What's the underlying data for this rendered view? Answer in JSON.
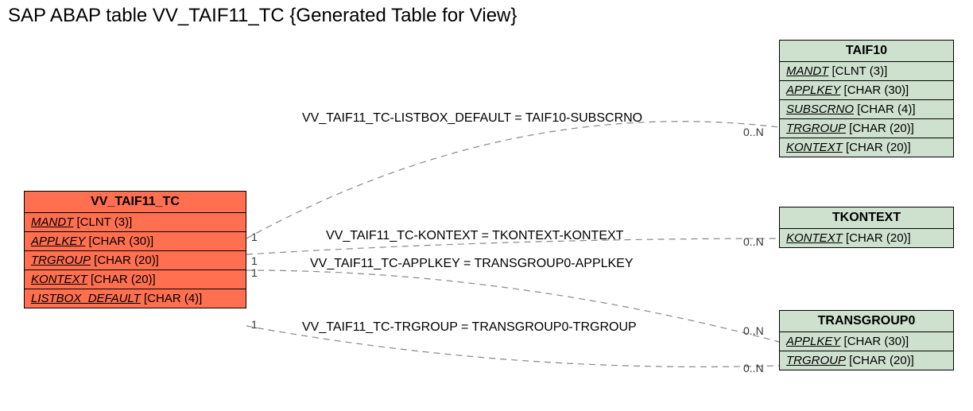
{
  "title": "SAP ABAP table VV_TAIF11_TC {Generated Table for View}",
  "entities": {
    "main": {
      "name": "VV_TAIF11_TC",
      "fields": [
        {
          "key": "MANDT",
          "type": "[CLNT (3)]"
        },
        {
          "key": "APPLKEY",
          "type": "[CHAR (30)]"
        },
        {
          "key": "TRGROUP",
          "type": "[CHAR (20)]"
        },
        {
          "key": "KONTEXT",
          "type": "[CHAR (20)]"
        },
        {
          "key": "LISTBOX_DEFAULT",
          "type": "[CHAR (4)]"
        }
      ]
    },
    "taif10": {
      "name": "TAIF10",
      "fields": [
        {
          "key": "MANDT",
          "type": "[CLNT (3)]"
        },
        {
          "key": "APPLKEY",
          "type": "[CHAR (30)]"
        },
        {
          "key": "SUBSCRNO",
          "type": "[CHAR (4)]"
        },
        {
          "key": "TRGROUP",
          "type": "[CHAR (20)]"
        },
        {
          "key": "KONTEXT",
          "type": "[CHAR (20)]"
        }
      ]
    },
    "tkontext": {
      "name": "TKONTEXT",
      "fields": [
        {
          "key": "KONTEXT",
          "type": "[CHAR (20)]"
        }
      ]
    },
    "transgroup0": {
      "name": "TRANSGROUP0",
      "fields": [
        {
          "key": "APPLKEY",
          "type": "[CHAR (30)]"
        },
        {
          "key": "TRGROUP",
          "type": "[CHAR (20)]"
        }
      ]
    }
  },
  "relations": {
    "r1": {
      "label": "VV_TAIF11_TC-LISTBOX_DEFAULT = TAIF10-SUBSCRNO",
      "left_card": "1",
      "right_card": "0..N"
    },
    "r2": {
      "label": "VV_TAIF11_TC-KONTEXT = TKONTEXT-KONTEXT",
      "left_card": "1",
      "right_card": "0..N"
    },
    "r3": {
      "label": "VV_TAIF11_TC-APPLKEY = TRANSGROUP0-APPLKEY",
      "left_card": "1",
      "right_card": "0..N"
    },
    "r4": {
      "label": "VV_TAIF11_TC-TRGROUP = TRANSGROUP0-TRGROUP",
      "left_card": "1",
      "right_card": "0..N"
    }
  },
  "chart_data": {
    "type": "table",
    "description": "Entity-relationship diagram for SAP ABAP view VV_TAIF11_TC",
    "entities": [
      {
        "name": "VV_TAIF11_TC",
        "fields": [
          "MANDT CLNT(3)",
          "APPLKEY CHAR(30)",
          "TRGROUP CHAR(20)",
          "KONTEXT CHAR(20)",
          "LISTBOX_DEFAULT CHAR(4)"
        ],
        "primary": true
      },
      {
        "name": "TAIF10",
        "fields": [
          "MANDT CLNT(3)",
          "APPLKEY CHAR(30)",
          "SUBSCRNO CHAR(4)",
          "TRGROUP CHAR(20)",
          "KONTEXT CHAR(20)"
        ]
      },
      {
        "name": "TKONTEXT",
        "fields": [
          "KONTEXT CHAR(20)"
        ]
      },
      {
        "name": "TRANSGROUP0",
        "fields": [
          "APPLKEY CHAR(30)",
          "TRGROUP CHAR(20)"
        ]
      }
    ],
    "relations": [
      {
        "from": "VV_TAIF11_TC.LISTBOX_DEFAULT",
        "to": "TAIF10.SUBSCRNO",
        "cardinality_from": "1",
        "cardinality_to": "0..N"
      },
      {
        "from": "VV_TAIF11_TC.KONTEXT",
        "to": "TKONTEXT.KONTEXT",
        "cardinality_from": "1",
        "cardinality_to": "0..N"
      },
      {
        "from": "VV_TAIF11_TC.APPLKEY",
        "to": "TRANSGROUP0.APPLKEY",
        "cardinality_from": "1",
        "cardinality_to": "0..N"
      },
      {
        "from": "VV_TAIF11_TC.TRGROUP",
        "to": "TRANSGROUP0.TRGROUP",
        "cardinality_from": "1",
        "cardinality_to": "0..N"
      }
    ]
  }
}
